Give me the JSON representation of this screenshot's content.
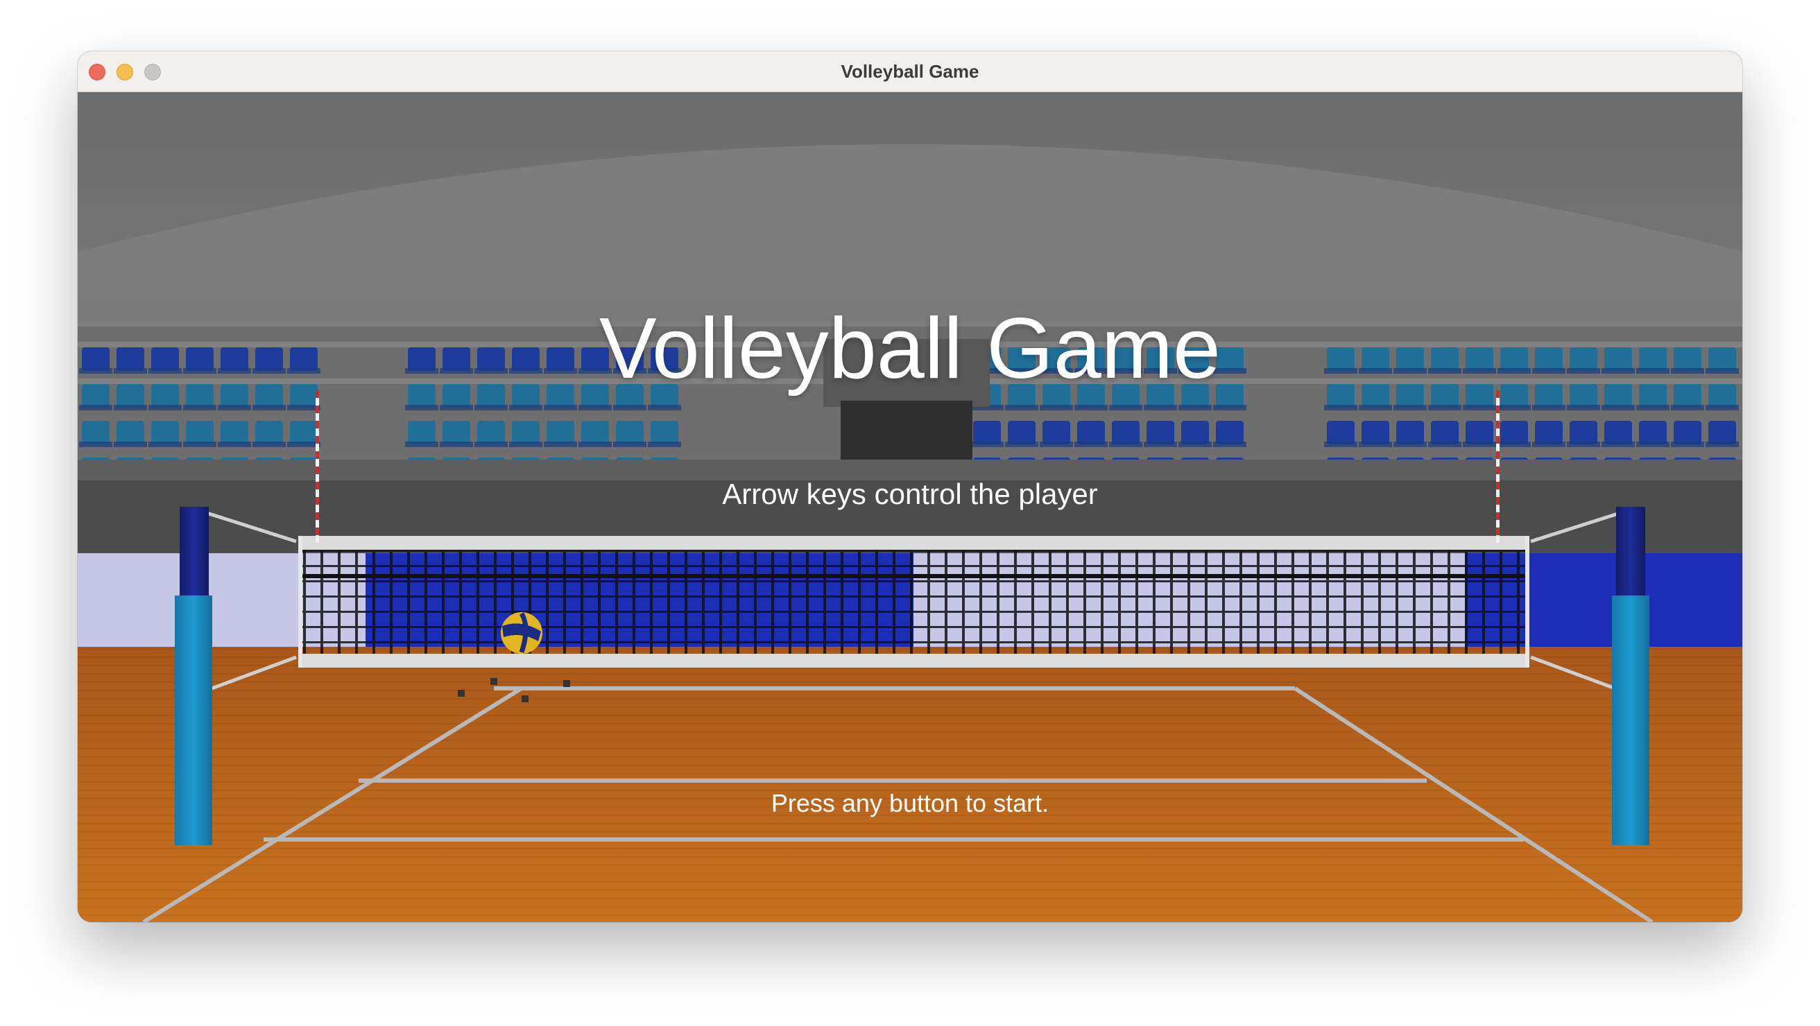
{
  "window": {
    "title": "Volleyball Game",
    "controls": [
      "close",
      "minimize",
      "maximize"
    ]
  },
  "screen": {
    "title": "Volleyball Game",
    "instructions": "Arrow keys control the player",
    "start_prompt": "Press any button to start."
  },
  "scene": {
    "elements": [
      "arena-dome",
      "spectator-seats",
      "scoreboard",
      "volleyball-net",
      "net-posts",
      "court-floor",
      "volleyball"
    ],
    "colors": {
      "court": "#c06a1e",
      "court_lines": "#bdbdbd",
      "seats_blue": "#1e3c9c",
      "seats_teal": "#1f6f98",
      "post_blue": "#1a8fc1",
      "wall_blue": "#1b2fb5",
      "dome": "#777777"
    }
  }
}
